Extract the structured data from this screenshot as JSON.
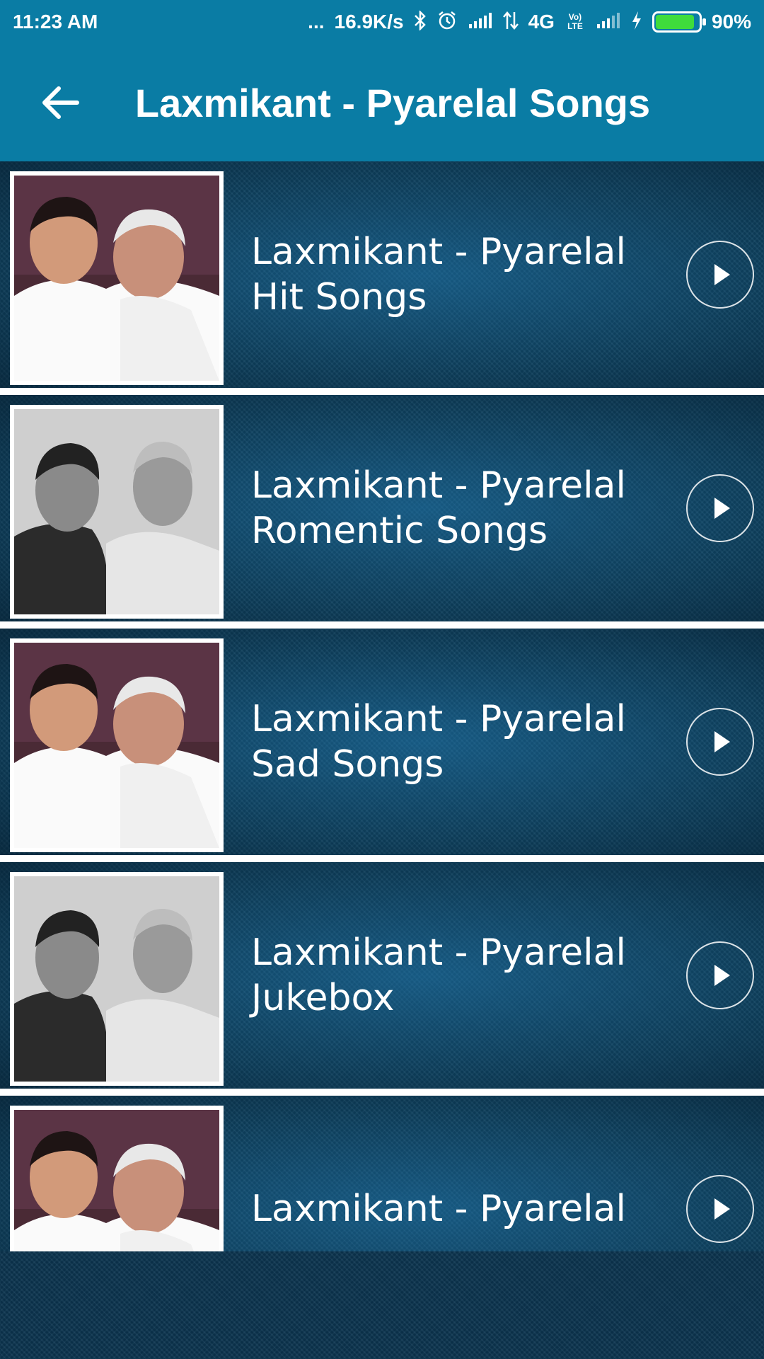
{
  "status_bar": {
    "time": "11:23 AM",
    "dots": "...",
    "speed": "16.9K/s",
    "network": "4G",
    "volte": "Vo) LTE",
    "battery": "90%",
    "battery_level": 0.9,
    "icons": [
      "bluetooth-icon",
      "alarm-icon",
      "signal-icon",
      "data-arrows-icon",
      "signal-icon",
      "charging-icon",
      "battery-icon"
    ]
  },
  "app_bar": {
    "title": "Laxmikant - Pyarelal Songs",
    "back_icon": "arrow-left-icon"
  },
  "colors": {
    "primary": "#0a7ca4",
    "list_background": "#0f4767",
    "separator": "#ffffff",
    "text": "#ffffff"
  },
  "playlists": [
    {
      "line1": "Laxmikant - Pyarelal",
      "line2": "Hit Songs",
      "photo": "color"
    },
    {
      "line1": "Laxmikant - Pyarelal",
      "line2": "Romentic Songs",
      "photo": "bw"
    },
    {
      "line1": "Laxmikant - Pyarelal",
      "line2": "Sad Songs",
      "photo": "color"
    },
    {
      "line1": "Laxmikant - Pyarelal",
      "line2": "Jukebox",
      "photo": "bw"
    },
    {
      "line1": "Laxmikant - Pyarelal",
      "line2": "",
      "photo": "color"
    }
  ]
}
